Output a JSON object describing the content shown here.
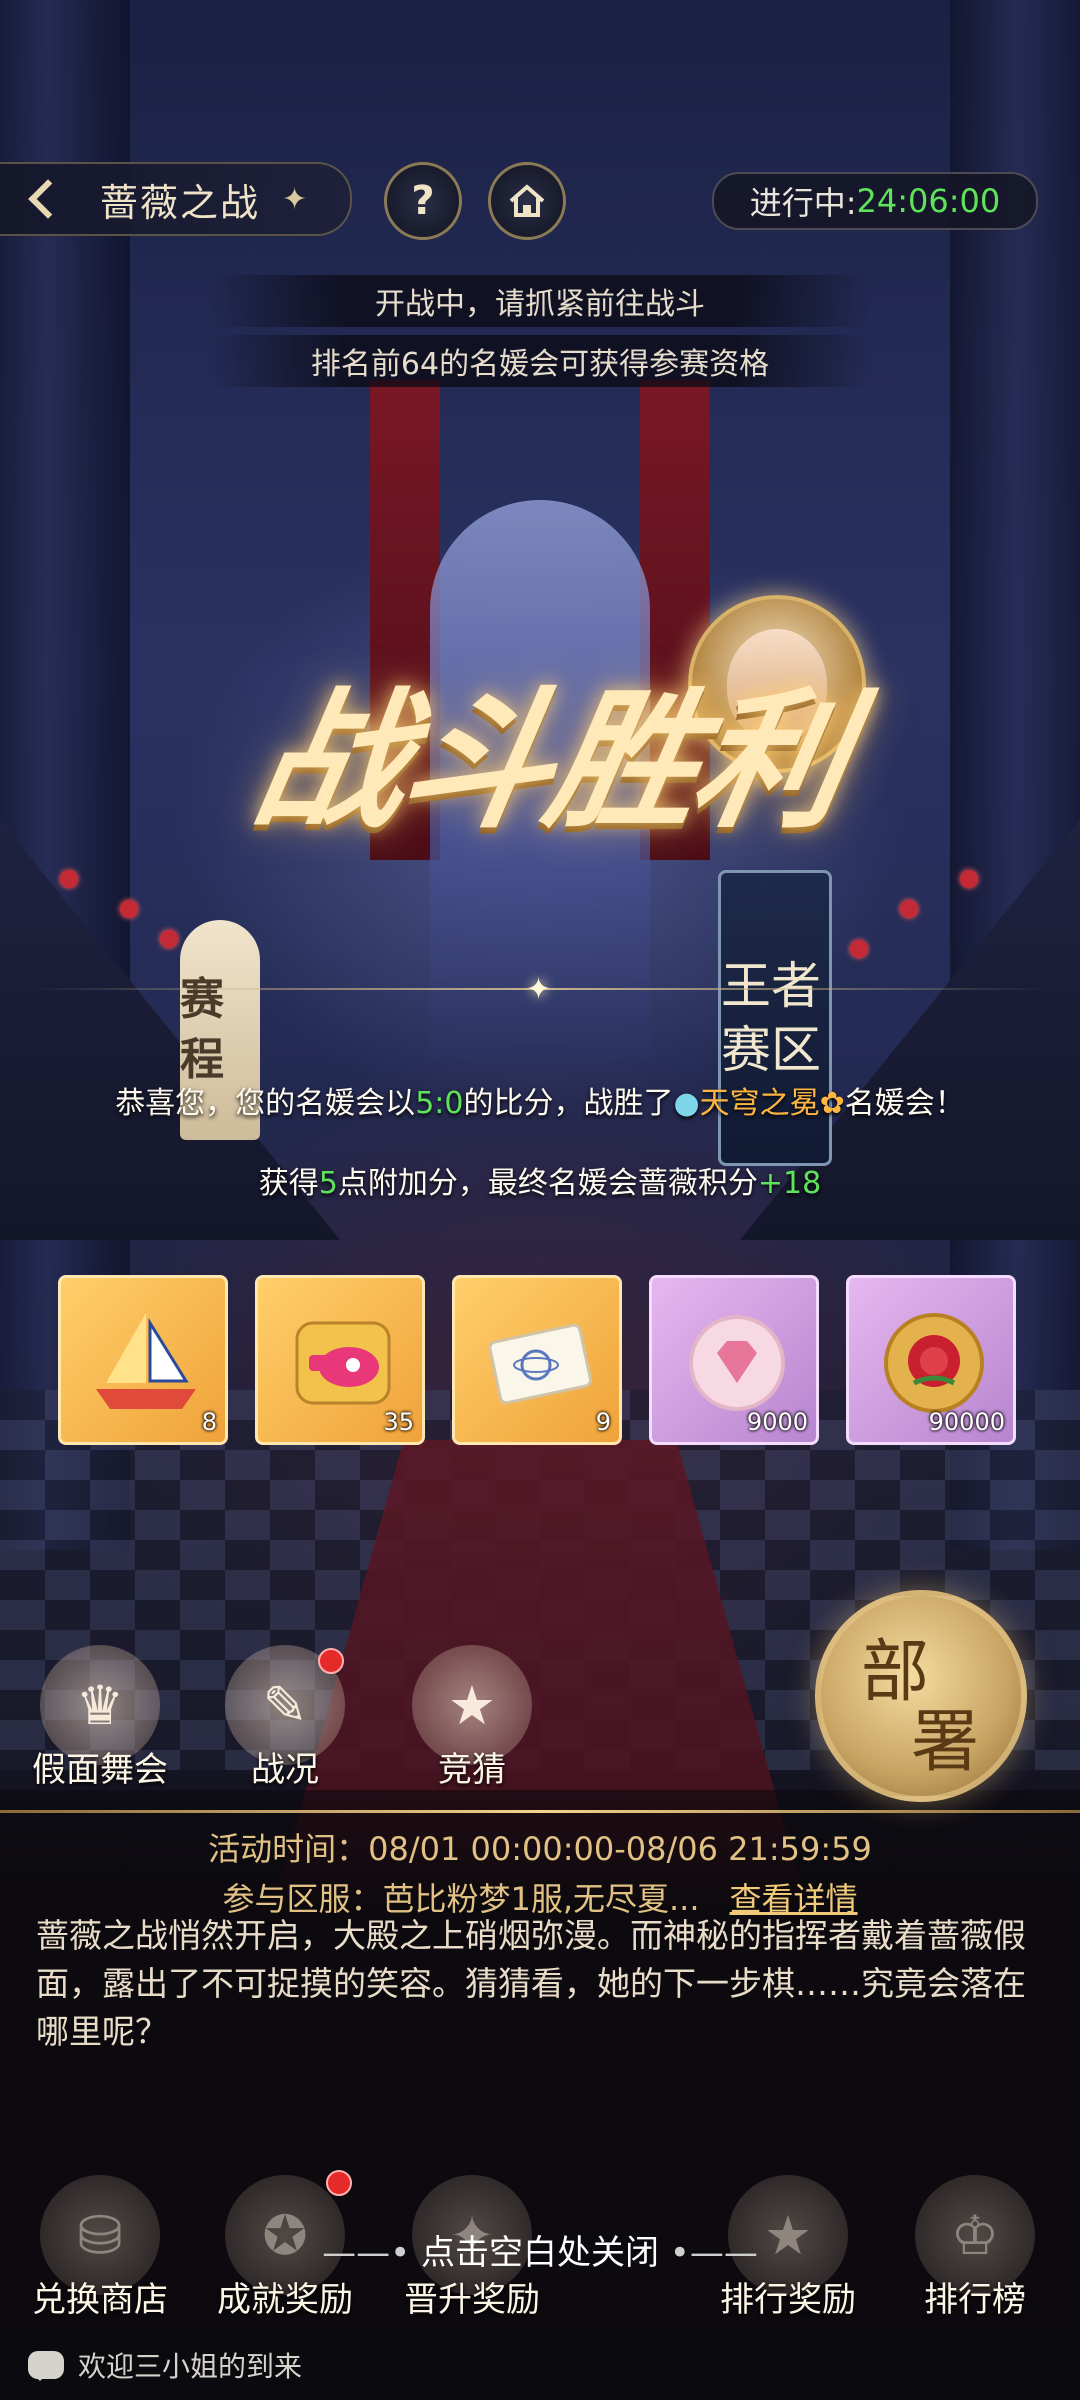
{
  "header": {
    "title": "蔷薇之战",
    "help_label": "?",
    "status_label": "进行中:",
    "countdown": "24:06:00"
  },
  "notices": [
    "开战中，请抓紧前往战斗",
    "排名前64的名媛会可获得参赛资格"
  ],
  "result": {
    "title": "战斗胜利",
    "zone_tag": "王者赛区",
    "schedule_tag": "赛程",
    "msg_prefix": "恭喜您，您的名媛会以",
    "score": "5:0",
    "msg_mid": "的比分，战胜了",
    "opponent": "天穹之冕",
    "msg_suffix": "名媛会！",
    "bonus_prefix": "获得",
    "bonus_points": "5",
    "bonus_mid": "点附加分，最终名媛会蔷薇积分",
    "final_points": "+18"
  },
  "rewards": [
    {
      "icon": "sailboat-icon",
      "count": "8",
      "style": "gold"
    },
    {
      "icon": "whistle-puzzle-icon",
      "count": "35",
      "style": "gold"
    },
    {
      "icon": "ticket-icon",
      "count": "9",
      "style": "gold"
    },
    {
      "icon": "diamond-coin-icon",
      "count": "9000",
      "style": "purple"
    },
    {
      "icon": "rose-coin-icon",
      "count": "90000",
      "style": "purple"
    }
  ],
  "side_menu": {
    "masquerade": "假面舞会",
    "battle_status": "战况",
    "guess": "竞猜",
    "deploy_line1": "部",
    "deploy_line2": "署"
  },
  "event": {
    "time_label": "活动时间：",
    "time_value": "08/01 00:00:00-08/06 21:59:59",
    "servers_label": "参与区服：",
    "servers_value": "芭比粉梦1服,无尽夏...",
    "details_link": "查看详情",
    "story": "蔷薇之战悄然开启，大殿之上硝烟弥漫。而神秘的指挥者戴着蔷薇假面，露出了不可捉摸的笑容。猜猜看，她的下一步棋……究竟会落在哪里呢？"
  },
  "bottom_menu": {
    "shop": "兑换商店",
    "achievement": "成就奖励",
    "promotion": "晋升奖励",
    "rank_reward": "排行奖励",
    "leaderboard": "排行榜",
    "close_hint": "点击空白处关闭"
  },
  "chat": {
    "message": "欢迎三小姐的到来"
  },
  "colors": {
    "highlight_green": "#5ee35a",
    "opponent_orange": "#ffb640",
    "gold": "#e2c184"
  }
}
